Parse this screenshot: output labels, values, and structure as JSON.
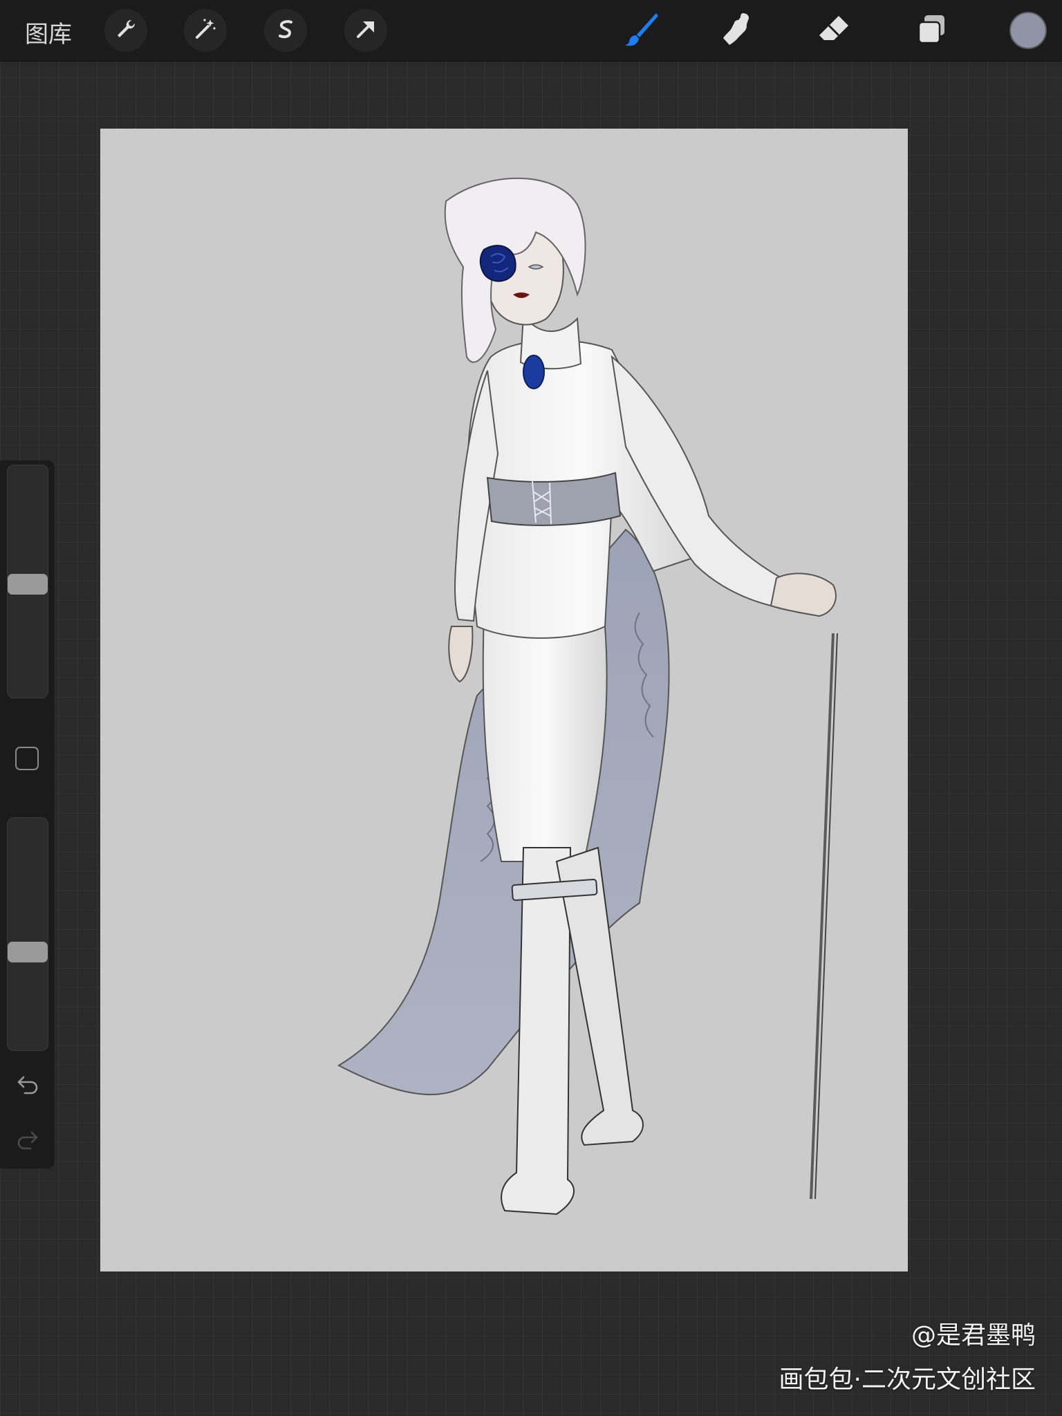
{
  "topbar": {
    "gallery_label": "图库",
    "left_tools": [
      "wrench-icon",
      "magic-wand-icon",
      "selection-s-icon",
      "arrow-transform-icon"
    ],
    "right_tools": [
      "brush-icon",
      "smudge-icon",
      "eraser-icon",
      "layers-icon"
    ],
    "active_tool": "brush",
    "accent_color": "#1e7df2",
    "current_color": "#8f95a6"
  },
  "sidebar": {
    "brush_size_level": 0.49,
    "opacity_level": 0.42
  },
  "canvas": {
    "background_color": "#cbcbcb",
    "artwork": "fashion-figure-illustration"
  },
  "watermark": {
    "author": "@是君墨鸭",
    "site": "画包包·二次元文创社区"
  }
}
